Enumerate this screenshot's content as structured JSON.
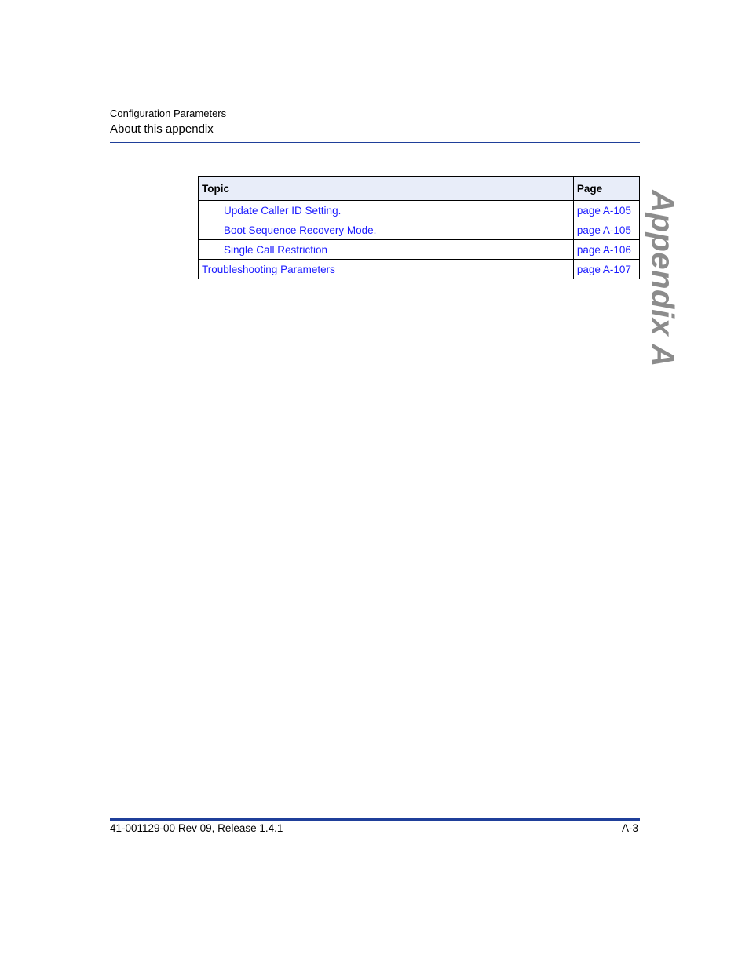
{
  "header": {
    "chapter": "Configuration Parameters",
    "section": "About this appendix"
  },
  "table": {
    "columns": [
      "Topic",
      "Page"
    ],
    "rows": [
      {
        "topic": "Update Caller ID Setting.",
        "page": "page A-105",
        "indent": true
      },
      {
        "topic": "Boot Sequence Recovery Mode.",
        "page": "page A-105",
        "indent": true
      },
      {
        "topic": "Single Call Restriction",
        "page": "page A-106",
        "indent": true
      },
      {
        "topic": "Troubleshooting Parameters",
        "page": "page A-107",
        "indent": false
      }
    ]
  },
  "side_tab": {
    "label": "Appendix A"
  },
  "footer": {
    "document": "41-001129-00 Rev 09, Release 1.4.1",
    "page_number": "A-3"
  },
  "colors": {
    "rule": "#1f3f9a",
    "link": "#1a1aff",
    "table_header_bg": "#e8edf9",
    "side_tab_text": "#8c8c8c"
  }
}
